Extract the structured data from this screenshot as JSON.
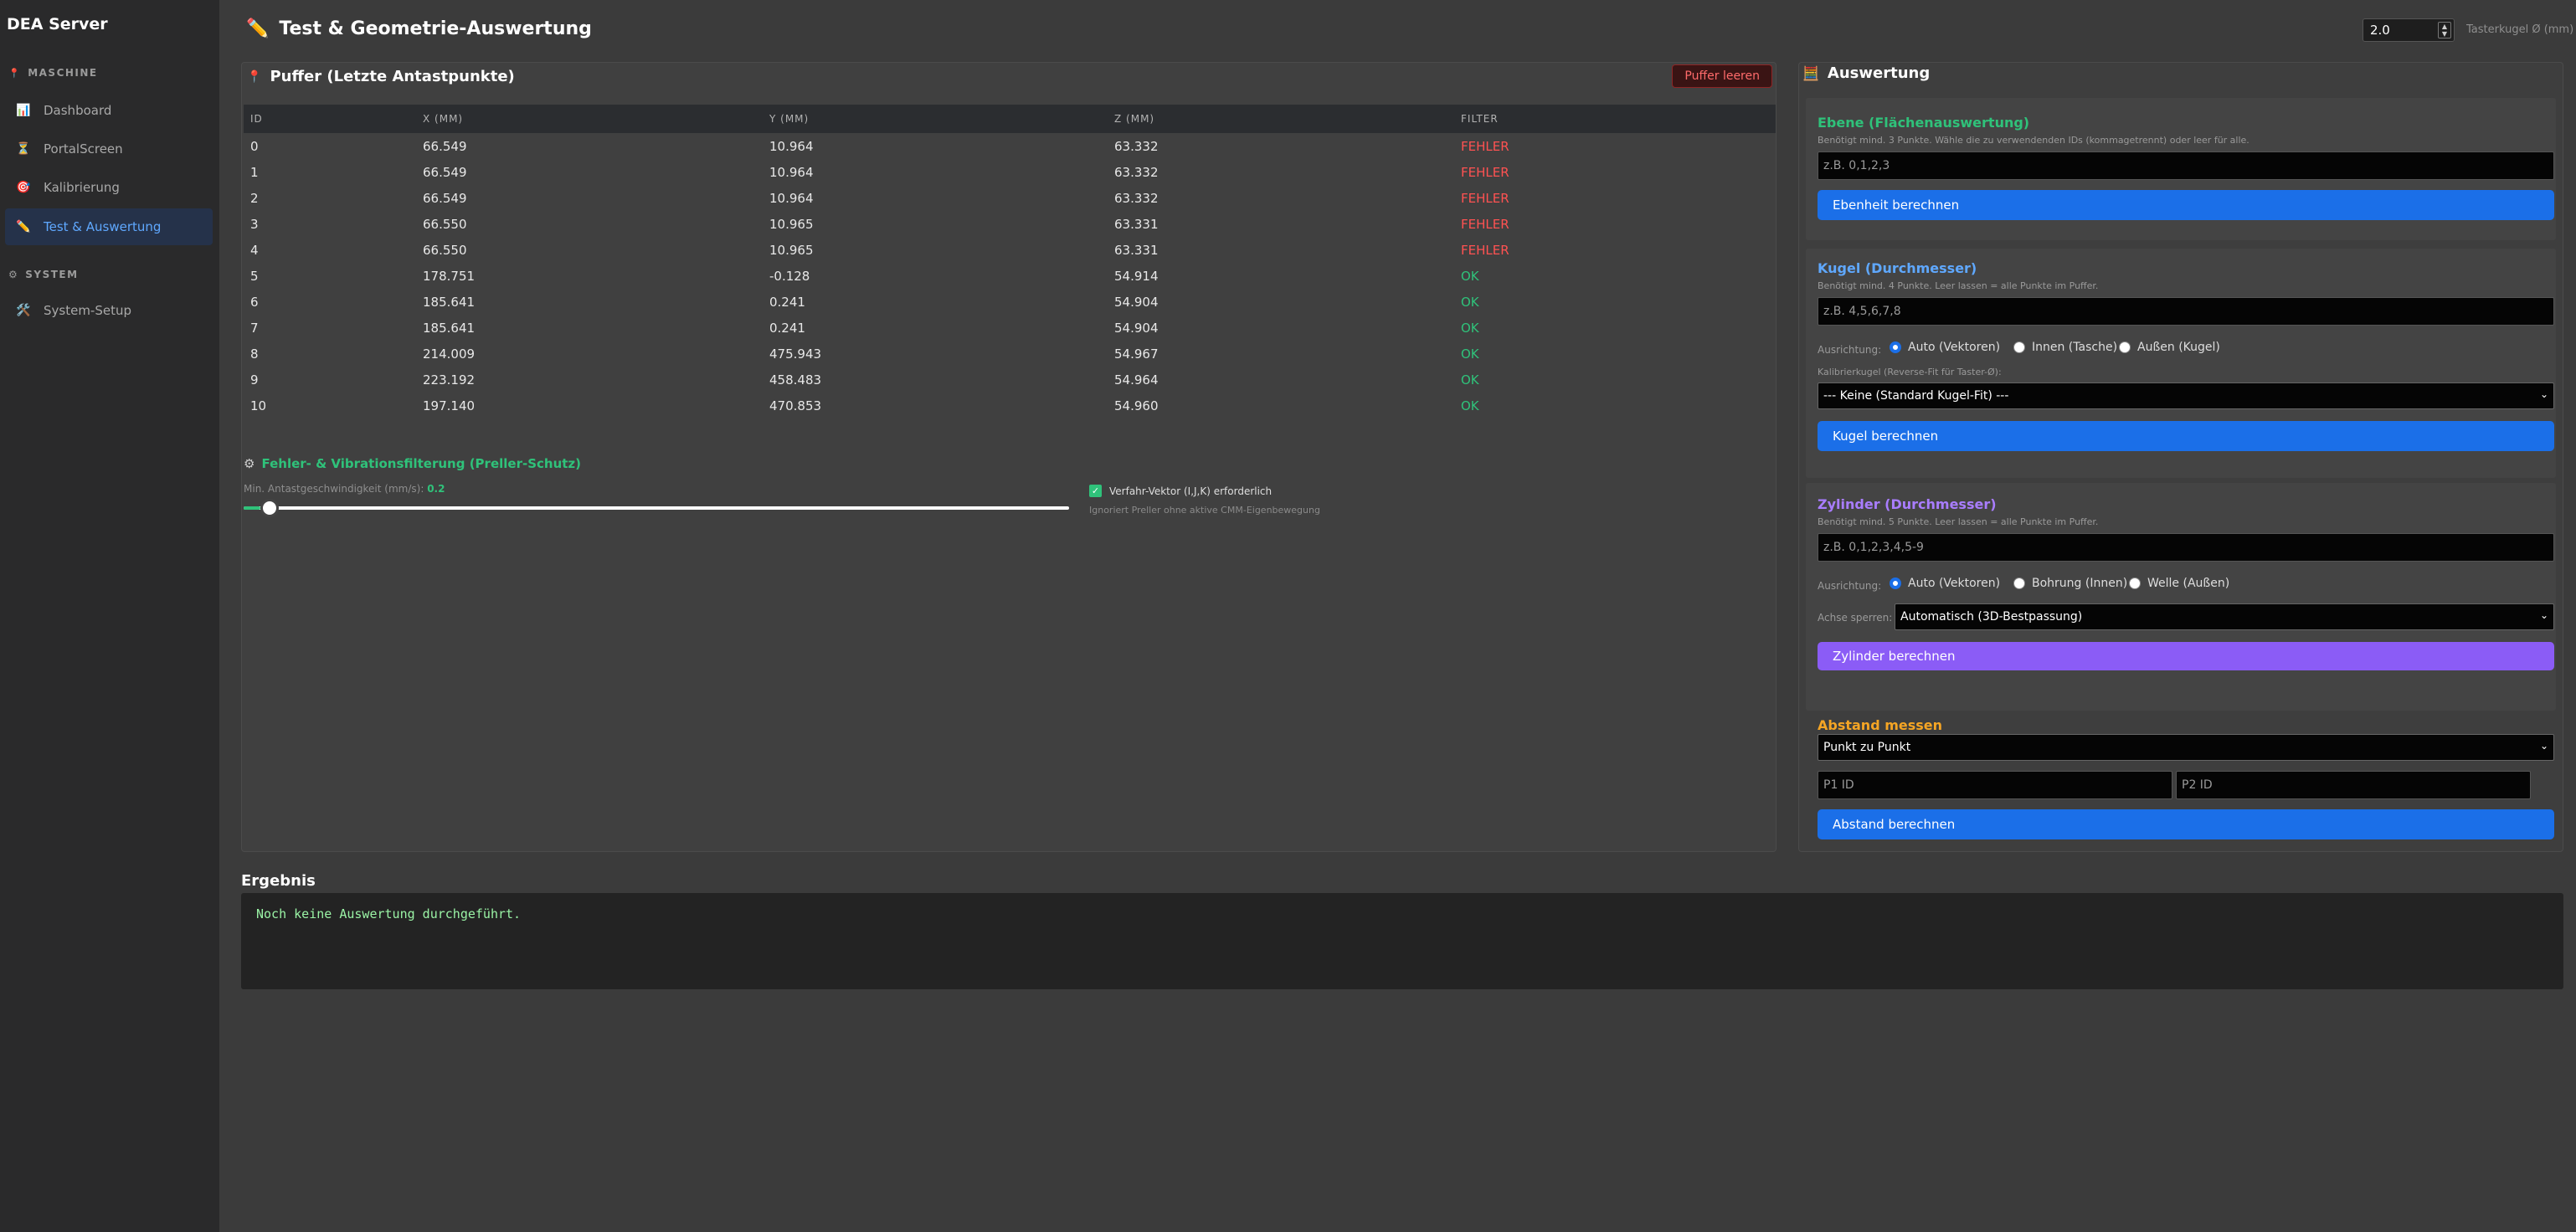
{
  "app": {
    "title": "DEA Server"
  },
  "sidebar": {
    "sections": [
      {
        "label": "MASCHINE"
      },
      {
        "label": "SYSTEM"
      }
    ],
    "items": [
      {
        "label": "Dashboard",
        "icon": "chart-icon"
      },
      {
        "label": "PortalScreen",
        "icon": "hourglass-icon"
      },
      {
        "label": "Kalibrierung",
        "icon": "target-icon"
      },
      {
        "label": "Test & Auswertung",
        "icon": "pencil-icon",
        "active": true
      },
      {
        "label": "System-Setup",
        "icon": "tools-icon"
      }
    ]
  },
  "header": {
    "title": "Test & Geometrie-Auswertung",
    "probe_value": "2.0",
    "probe_label": "Tasterkugel Ø (mm)"
  },
  "buffer": {
    "title": "Puffer (Letzte Antastpunkte)",
    "clear_label": "Puffer leeren",
    "columns": [
      "ID",
      "X (MM)",
      "Y (MM)",
      "Z (MM)",
      "FILTER"
    ],
    "rows": [
      [
        "0",
        "66.549",
        "10.964",
        "63.332",
        "FEHLER"
      ],
      [
        "1",
        "66.549",
        "10.964",
        "63.332",
        "FEHLER"
      ],
      [
        "2",
        "66.549",
        "10.964",
        "63.332",
        "FEHLER"
      ],
      [
        "3",
        "66.550",
        "10.965",
        "63.331",
        "FEHLER"
      ],
      [
        "4",
        "66.550",
        "10.965",
        "63.331",
        "FEHLER"
      ],
      [
        "5",
        "178.751",
        "-0.128",
        "54.914",
        "OK"
      ],
      [
        "6",
        "185.641",
        "0.241",
        "54.904",
        "OK"
      ],
      [
        "7",
        "185.641",
        "0.241",
        "54.904",
        "OK"
      ],
      [
        "8",
        "214.009",
        "475.943",
        "54.967",
        "OK"
      ],
      [
        "9",
        "223.192",
        "458.483",
        "54.964",
        "OK"
      ],
      [
        "10",
        "197.140",
        "470.853",
        "54.960",
        "OK"
      ]
    ]
  },
  "filter": {
    "title": "Fehler- & Vibrationsfilterung (Preller-Schutz)",
    "speed_label": "Min. Antastgeschwindigkeit (mm/s):",
    "speed_value": "0.2",
    "slider_fraction": 0.02,
    "vector_label": "Verfahr-Vektor (I,J,K) erforderlich",
    "vector_checked": true,
    "vector_hint": "Ignoriert Preller ohne aktive CMM-Eigenbewegung"
  },
  "evaluation": {
    "title": "Auswertung",
    "plane": {
      "title": "Ebene (Flächenauswertung)",
      "hint": "Benötigt mind. 3 Punkte. Wähle die zu verwendenden IDs (kommagetrennt) oder leer für alle.",
      "placeholder": "z.B. 0,1,2,3",
      "button": "Ebenheit berechnen"
    },
    "sphere": {
      "title": "Kugel (Durchmesser)",
      "hint": "Benötigt mind. 4 Punkte. Leer lassen = alle Punkte im Puffer.",
      "placeholder": "z.B. 4,5,6,7,8",
      "orientation_label": "Ausrichtung:",
      "options": [
        "Auto (Vektoren)",
        "Innen (Tasche)",
        "Außen (Kugel)"
      ],
      "calib_label": "Kalibrierkugel (Reverse-Fit für Taster-Ø):",
      "calib_value": "--- Keine (Standard Kugel-Fit) ---",
      "button": "Kugel berechnen"
    },
    "cylinder": {
      "title": "Zylinder (Durchmesser)",
      "hint": "Benötigt mind. 5 Punkte. Leer lassen = alle Punkte im Puffer.",
      "placeholder": "z.B. 0,1,2,3,4,5-9",
      "orientation_label": "Ausrichtung:",
      "options": [
        "Auto (Vektoren)",
        "Bohrung (Innen)",
        "Welle (Außen)"
      ],
      "axis_label": "Achse sperren:",
      "axis_value": "Automatisch (3D-Bestpassung)",
      "button": "Zylinder berechnen"
    },
    "distance": {
      "title": "Abstand messen",
      "mode_value": "Punkt zu Punkt",
      "p1_placeholder": "P1 ID",
      "p2_placeholder": "P2 ID",
      "button": "Abstand berechnen"
    }
  },
  "result": {
    "title": "Ergebnis",
    "text": "Noch keine Auswertung durchgeführt."
  },
  "colors": {
    "accent_blue": "#1b6fe8",
    "accent_purple": "#8b5cf6",
    "ok_green": "#2fc27a",
    "error_red": "#ff5252",
    "plane_title": "#2fc27a",
    "sphere_title": "#5fa8ff",
    "cylinder_title": "#a97dff",
    "distance_title": "#f5a524"
  }
}
